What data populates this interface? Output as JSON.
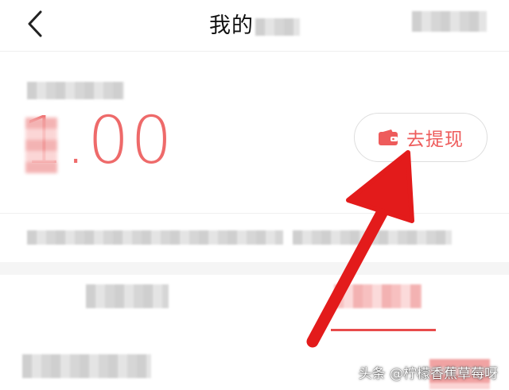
{
  "header": {
    "title": "我的"
  },
  "balance": {
    "amount": "1.00"
  },
  "withdraw": {
    "label": "去提现"
  },
  "watermark": {
    "text": "头条 @柠檬香蕉草莓呀"
  },
  "colors": {
    "accent": "#ee5b5b",
    "amount": "#ee6a6a",
    "arrow": "#e31b1b"
  },
  "icons": {
    "back": "chevron-left-icon",
    "wallet": "wallet-icon",
    "annotation": "arrow-annotation"
  }
}
